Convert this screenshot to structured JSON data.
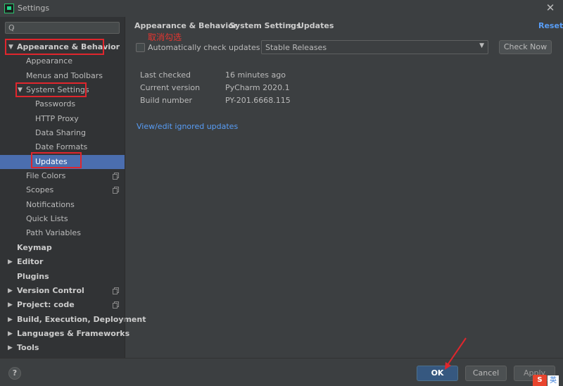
{
  "window": {
    "title": "Settings",
    "close_glyph": "✕"
  },
  "search": {
    "placeholder": "",
    "value": "",
    "icon": "search-icon"
  },
  "sidebar": {
    "items": [
      {
        "label": "Appearance & Behavior",
        "level": 0,
        "expanded": true,
        "bold": true
      },
      {
        "label": "Appearance",
        "level": 1
      },
      {
        "label": "Menus and Toolbars",
        "level": 1
      },
      {
        "label": "System Settings",
        "level": 1,
        "expanded": true
      },
      {
        "label": "Passwords",
        "level": 2
      },
      {
        "label": "HTTP Proxy",
        "level": 2
      },
      {
        "label": "Data Sharing",
        "level": 2
      },
      {
        "label": "Date Formats",
        "level": 2
      },
      {
        "label": "Updates",
        "level": 2,
        "selected": true
      },
      {
        "label": "File Colors",
        "level": 1,
        "copy_icon": true
      },
      {
        "label": "Scopes",
        "level": 1,
        "copy_icon": true
      },
      {
        "label": "Notifications",
        "level": 1
      },
      {
        "label": "Quick Lists",
        "level": 1
      },
      {
        "label": "Path Variables",
        "level": 1
      },
      {
        "label": "Keymap",
        "level": 0,
        "bold": true
      },
      {
        "label": "Editor",
        "level": 0,
        "bold": true,
        "collapsed": true
      },
      {
        "label": "Plugins",
        "level": 0,
        "bold": true
      },
      {
        "label": "Version Control",
        "level": 0,
        "bold": true,
        "collapsed": true,
        "copy_icon": true
      },
      {
        "label": "Project: code",
        "level": 0,
        "bold": true,
        "collapsed": true,
        "copy_icon": true
      },
      {
        "label": "Build, Execution, Deployment",
        "level": 0,
        "bold": true,
        "collapsed": true
      },
      {
        "label": "Languages & Frameworks",
        "level": 0,
        "bold": true,
        "collapsed": true
      },
      {
        "label": "Tools",
        "level": 0,
        "bold": true,
        "collapsed": true
      }
    ]
  },
  "breadcrumb": {
    "items": [
      "Appearance & Behavior",
      "System Settings",
      "Updates"
    ],
    "separator": "›"
  },
  "reset_label": "Reset",
  "annotation_text": "取消勾选",
  "updates": {
    "auto_check_label": "Automatically check updates for",
    "auto_check_checked": false,
    "channel_value": "Stable Releases",
    "check_now_label": "Check Now",
    "info": [
      {
        "key": "Last checked",
        "value": "16 minutes ago"
      },
      {
        "key": "Current version",
        "value": "PyCharm 2020.1"
      },
      {
        "key": "Build number",
        "value": "PY-201.6668.115"
      }
    ],
    "ignored_link": "View/edit ignored updates"
  },
  "footer": {
    "help": "?",
    "ok": "OK",
    "cancel": "Cancel",
    "apply": "Apply"
  },
  "ime": {
    "logo": "S",
    "lang": "英"
  },
  "colors": {
    "accent": "#4b6eaf",
    "link": "#589df6",
    "annotation": "#e0262d",
    "ok_button": "#365880"
  }
}
